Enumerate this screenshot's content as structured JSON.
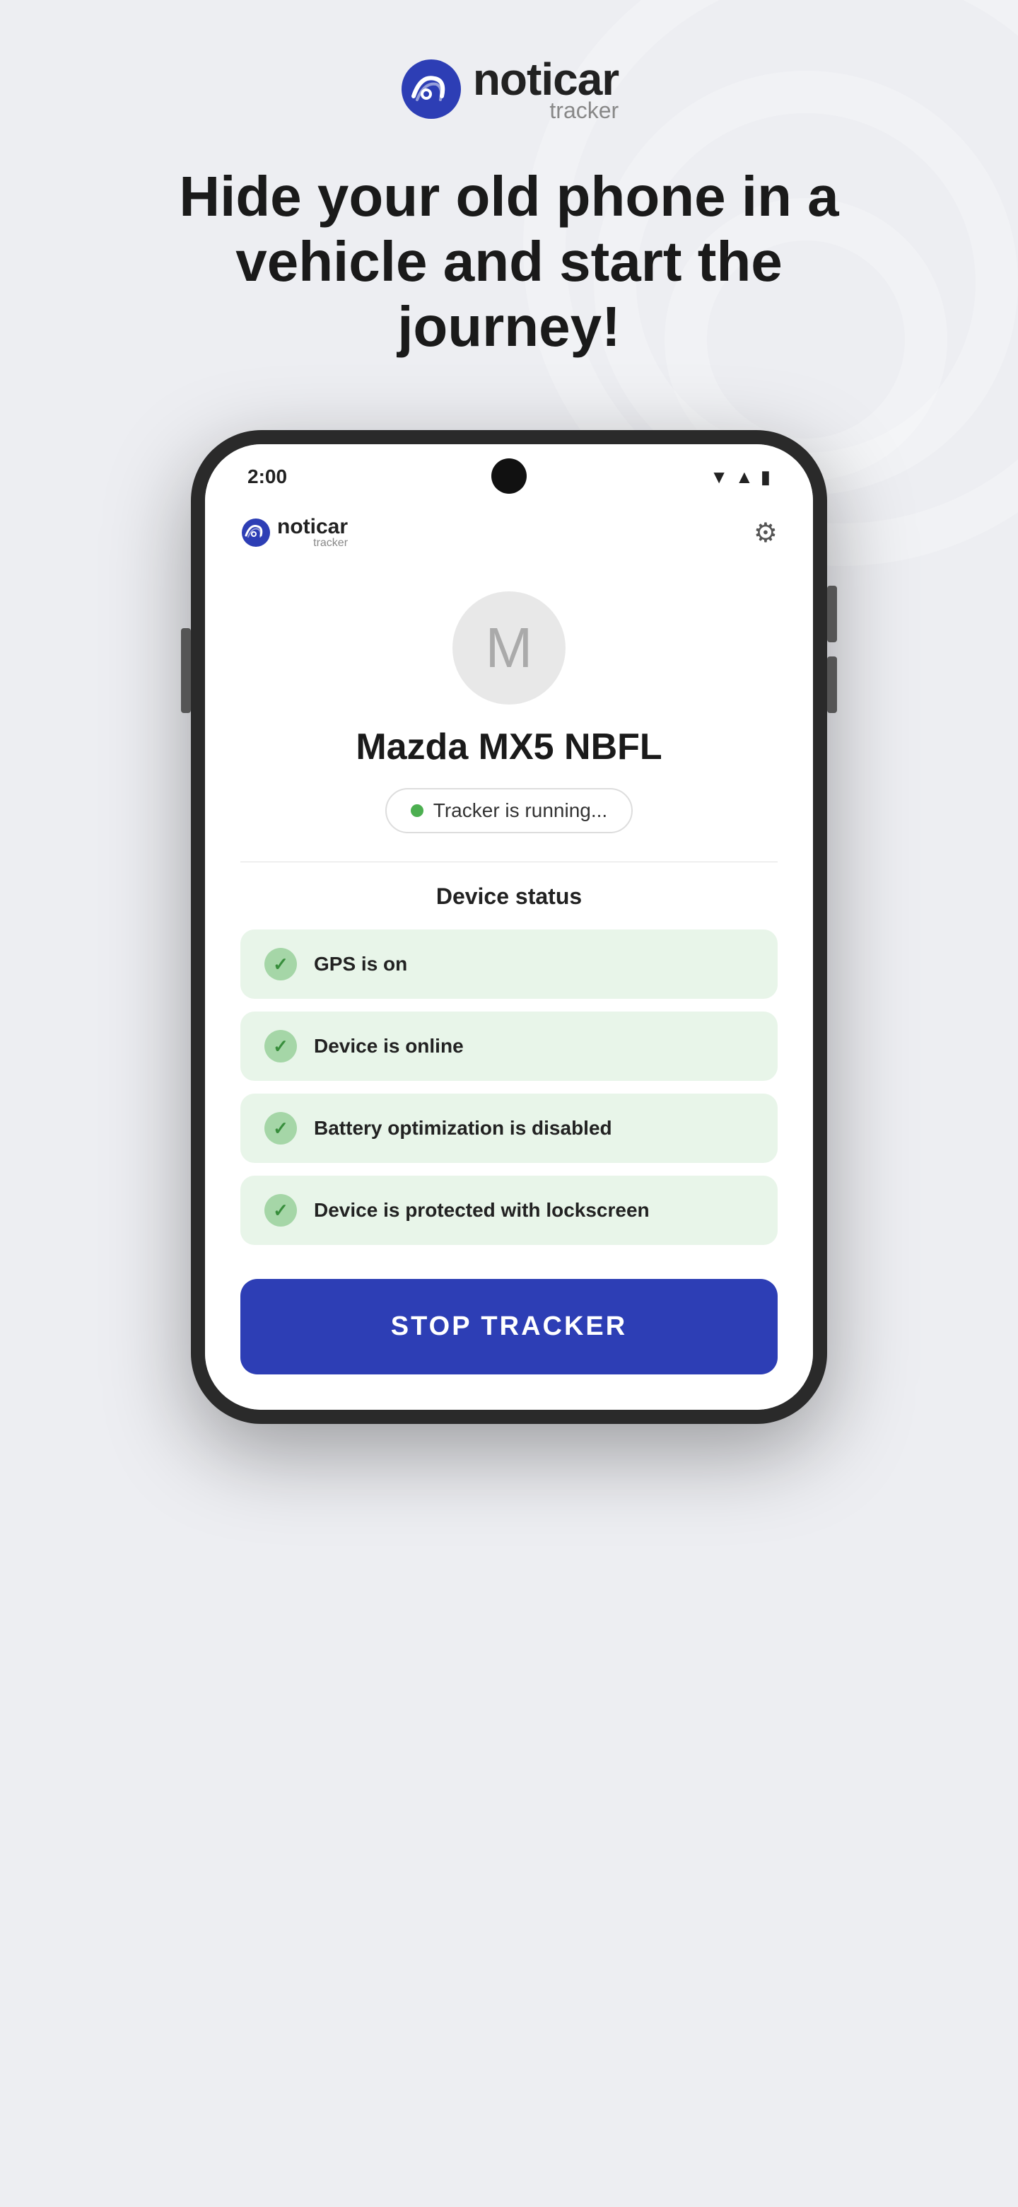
{
  "brand": {
    "name": "noticar",
    "sub": "tracker"
  },
  "headline": "Hide your old phone in a vehicle and start the journey!",
  "phone": {
    "status_bar": {
      "time": "2:00"
    },
    "app_header": {
      "settings_label": "⚙"
    },
    "vehicle": {
      "initial": "M",
      "name": "Mazda MX5 NBFL"
    },
    "tracker_status": {
      "text": "Tracker is running..."
    },
    "device_status": {
      "title": "Device status",
      "items": [
        {
          "label": "GPS is on"
        },
        {
          "label": "Device is online"
        },
        {
          "label": "Battery optimization is disabled"
        },
        {
          "label": "Device is protected with lockscreen"
        }
      ]
    },
    "stop_button": {
      "label": "STOP TRACKER"
    }
  },
  "colors": {
    "brand_blue": "#2d3eb5",
    "status_green": "#4caf50",
    "check_bg": "#a5d6a7",
    "item_bg": "#e8f5e9",
    "bg_page": "#edeef2"
  }
}
